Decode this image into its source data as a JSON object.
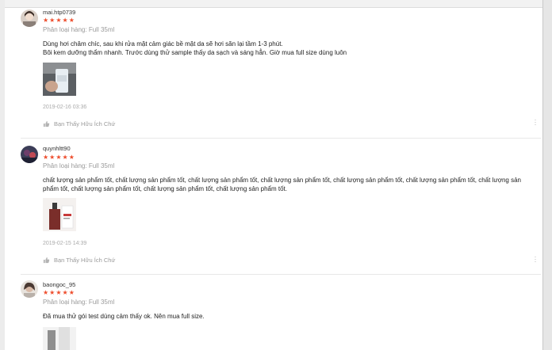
{
  "reviews": [
    {
      "username": "mai.htp0739",
      "stars": "★★★★★",
      "variant": "Phân loại hàng: Full 35ml",
      "comment_lines": [
        "Dùng hơi châm chíc, sau khi rửa mặt cảm giác bề mặt da sẽ hơi săn lại tầm 1-3 phút.",
        "Bôi kem dưỡng thẩm nhanh. Trước dùng thử sample thấy da sạch và sáng hẳn. Giờ mua full size dùng luôn"
      ],
      "time": "2019-02-16 03:36",
      "like_label": "Bạn Thấy Hữu Ích Chứ",
      "more_icon": "more-vertical-icon"
    },
    {
      "username": "quynhltt90",
      "stars": "★★★★★",
      "variant": "Phân loại hàng: Full 35ml",
      "comment_lines": [
        "chất lượng sản phẩm tốt, chất lượng sản phẩm tốt, chất lượng sản phẩm tốt, chất lượng sản phẩm tốt, chất lượng sản phẩm tốt, chất lượng sản phẩm tốt, chất lượng sản",
        "phẩm tốt, chất lượng sản phẩm tốt, chất lượng sản phẩm tốt, chất lượng sản phẩm tốt."
      ],
      "time": "2019-02-15 14:39",
      "like_label": "Bạn Thấy Hữu Ích Chứ",
      "more_icon": "more-vertical-icon"
    },
    {
      "username": "baongoc_95",
      "stars": "★★★★★",
      "variant": "Phân loại hàng: Full 35ml",
      "comment_lines": [
        "Đã mua thử gói test dùng cảm thấy ok. Nên mua full size."
      ],
      "time": "",
      "like_label": "",
      "more_icon": "more-vertical-icon"
    }
  ],
  "colors": {
    "star": "#ee4d2d",
    "muted": "#9a9a9a",
    "text": "#222222"
  }
}
